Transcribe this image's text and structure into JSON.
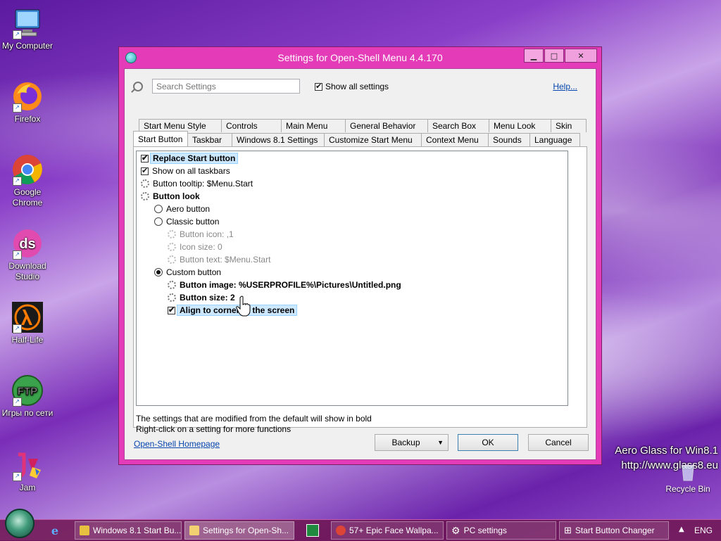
{
  "desktop": {
    "icons": [
      {
        "label": "My Computer"
      },
      {
        "label": "Firefox"
      },
      {
        "label": "Google Chrome"
      },
      {
        "label": "Download Studio"
      },
      {
        "label": "Half-Life"
      },
      {
        "label": "Игры по сети"
      },
      {
        "label": "Jam"
      }
    ],
    "watermark_line1": "Aero Glass for Win8.1",
    "watermark_line2": "http://www.glass8.eu",
    "recycle_bin": "Recycle Bin"
  },
  "window": {
    "title": "Settings for Open-Shell Menu 4.4.170",
    "search_placeholder": "Search Settings",
    "show_all_label": "Show all settings",
    "show_all_checked": true,
    "help_label": "Help...",
    "tabs_row1": [
      "Start Menu Style",
      "Controls",
      "Main Menu",
      "General Behavior",
      "Search Box",
      "Menu Look",
      "Skin"
    ],
    "tabs_row2": [
      "Start Button",
      "Taskbar",
      "Windows 8.1 Settings",
      "Customize Start Menu",
      "Context Menu",
      "Sounds",
      "Language"
    ],
    "active_tab": "Start Button",
    "settings": [
      {
        "label": "Replace Start button",
        "control": "check",
        "checked": true,
        "bold": true,
        "selected": true,
        "indent": 0
      },
      {
        "label": "Show on all taskbars",
        "control": "check",
        "checked": true,
        "bold": false,
        "indent": 0
      },
      {
        "label": "Button tooltip: $Menu.Start",
        "control": "gear",
        "bold": false,
        "indent": 0
      },
      {
        "label": "Button look",
        "control": "gear",
        "bold": true,
        "indent": 0
      },
      {
        "label": "Aero button",
        "control": "radio",
        "checked": false,
        "bold": false,
        "indent": 1
      },
      {
        "label": "Classic button",
        "control": "radio",
        "checked": false,
        "bold": false,
        "indent": 1
      },
      {
        "label": "Button icon: ,1",
        "control": "gear-dim",
        "bold": false,
        "gray": true,
        "indent": 2
      },
      {
        "label": "Icon size: 0",
        "control": "gear-dim",
        "bold": false,
        "gray": true,
        "indent": 2
      },
      {
        "label": "Button text: $Menu.Start",
        "control": "gear-dim",
        "bold": false,
        "gray": true,
        "indent": 2
      },
      {
        "label": "Custom button",
        "control": "radio",
        "checked": true,
        "bold": false,
        "indent": 1
      },
      {
        "label": "Button image: %USERPROFILE%\\Pictures\\Untitled.png",
        "control": "gear",
        "bold": true,
        "indent": 2
      },
      {
        "label": "Button size: 2",
        "control": "gear",
        "bold": true,
        "indent": 2
      },
      {
        "label": "Align to corner of the screen",
        "control": "check",
        "checked": true,
        "bold": true,
        "selected": true,
        "indent": 2
      }
    ],
    "note1": "The settings that are modified from the default will show in bold",
    "note2": "Right-click on a setting for more functions",
    "homepage_label": "Open-Shell Homepage",
    "backup_label": "Backup",
    "ok_label": "OK",
    "cancel_label": "Cancel"
  },
  "taskbar": {
    "items": [
      {
        "label": "Windows 8.1 Start Bu...",
        "color": "#e8c040"
      },
      {
        "label": "Settings for Open-Sh...",
        "color": "#f0d070"
      },
      {
        "label": "57+ Epic Face Wallpa...",
        "color": "#4a8ff0"
      },
      {
        "label": "PC settings",
        "color": "#7aa0ff"
      },
      {
        "label": "Start Button Changer",
        "color": "#ffffff"
      }
    ],
    "language": "ENG"
  }
}
